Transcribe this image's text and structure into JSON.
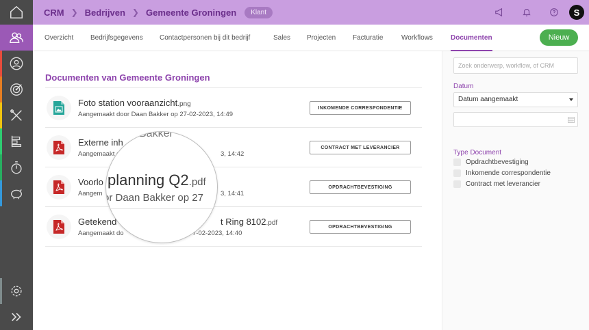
{
  "breadcrumb": {
    "items": [
      "CRM",
      "Bedrijven",
      "Gemeente Groningen"
    ],
    "status_badge": "Klant"
  },
  "top_icons": [
    "megaphone-icon",
    "bell-icon",
    "help-icon",
    "user-avatar"
  ],
  "sidebar": {
    "items": [
      {
        "icon": "home-icon",
        "color": "#4a4a4a"
      },
      {
        "icon": "users-icon",
        "color": "#9b59b6"
      },
      {
        "icon": "contact-icon",
        "color": "#e74c3c"
      },
      {
        "icon": "target-icon",
        "color": "#e67e22"
      },
      {
        "icon": "tools-icon",
        "color": "#f1c40f"
      },
      {
        "icon": "tasks-icon",
        "color": "#2ecc71"
      },
      {
        "icon": "stopwatch-icon",
        "color": "#27ae60"
      },
      {
        "icon": "piggy-bank-icon",
        "color": "#3498db"
      },
      {
        "icon": "gear-icon",
        "color": "#7f8c8d"
      },
      {
        "icon": "expand-icon",
        "color": "#4a4a4a"
      }
    ]
  },
  "tabs": [
    {
      "label": "Overzicht",
      "active": false
    },
    {
      "label": "Bedrijfsgegevens",
      "active": false
    },
    {
      "label": "Contactpersonen bij dit bedrijf",
      "active": false
    },
    {
      "label": "Sales",
      "active": false
    },
    {
      "label": "Projecten",
      "active": false
    },
    {
      "label": "Facturatie",
      "active": false
    },
    {
      "label": "Workflows",
      "active": false
    },
    {
      "label": "Documenten",
      "active": true
    }
  ],
  "new_button": "Nieuw",
  "main": {
    "title": "Documenten van Gemeente Groningen",
    "documents": [
      {
        "name": "Foto station vooraanzicht",
        "ext": ".png",
        "meta": "Aangemaakt door Daan Bakker op 27-02-2023, 14:49",
        "tag": "INKOMENDE CORRESPONDENTIE",
        "file_type": "image"
      },
      {
        "name": "Externe inh",
        "ext": "",
        "meta": "Aangemaakt do",
        "meta_tail": "3, 14:42",
        "tag": "CONTRACT MET LEVERANCIER",
        "file_type": "pdf"
      },
      {
        "name": "Voorlo",
        "ext": "",
        "meta": "Aangem",
        "meta_tail": "3, 14:41",
        "tag": "OPDRACHTBEVESTIGING",
        "file_type": "pdf"
      },
      {
        "name": "Getekend",
        "name_tail": "t Ring 8102",
        "ext": ".pdf",
        "meta": "Aangemaakt do",
        "meta_tail": "7-02-2023, 14:40",
        "tag": "OPDRACHTBEVESTIGING",
        "file_type": "pdf"
      }
    ],
    "magnifier": {
      "faint_text": "Bakker",
      "name": "planning Q2",
      "ext": ".pdf",
      "meta": "or Daan Bakker op 27"
    }
  },
  "filters": {
    "search_placeholder": "Zoek onderwerp, workflow, of CRM",
    "date_label": "Datum",
    "date_select": "Datum aangemaakt",
    "type_label": "Type Document",
    "types": [
      "Opdrachtbevestiging",
      "Inkomende correspondentie",
      "Contract met leverancier"
    ]
  },
  "colors": {
    "accent": "#8e44ad",
    "topbar": "#c99ee0",
    "sidebar": "#4a4a4a",
    "new_button": "#4caf50",
    "pdf_red": "#c62828",
    "image_teal": "#26a69a"
  }
}
